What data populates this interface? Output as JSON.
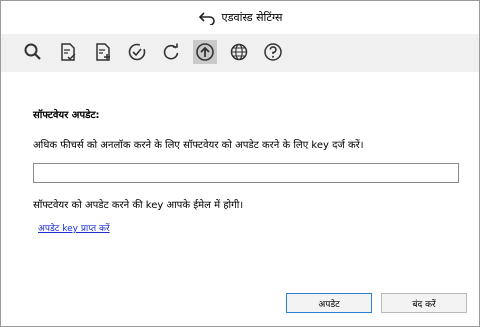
{
  "window": {
    "title": "एडवांस्ड सेटिंग्स"
  },
  "toolbar": {
    "items": [
      {
        "icon": "search-icon"
      },
      {
        "icon": "document-check-icon"
      },
      {
        "icon": "document-add-icon"
      },
      {
        "icon": "check-circle-icon"
      },
      {
        "icon": "refresh-icon"
      },
      {
        "icon": "upload-icon",
        "active": true
      },
      {
        "icon": "globe-icon"
      },
      {
        "icon": "help-icon"
      }
    ]
  },
  "main": {
    "heading": "सॉफ्टवेयर अपडेट:",
    "description": "अधिक फीचर्स को अनलॉक करने के लिए सॉफ्टवेयर को अपडेट करने के लिए key दर्ज करें।",
    "key_input": {
      "value": "",
      "placeholder": ""
    },
    "note": "सॉफ्टवेयर को अपडेट करने की key आपके ईमेल में होगी।",
    "link": "अपडेट key प्राप्त करें"
  },
  "footer": {
    "update_label": "अपडेट",
    "close_label": "बंद करें"
  },
  "colors": {
    "toolbar_bg": "#f0f0f0",
    "link": "#1a2fd6",
    "primary_border": "#2b7fd4"
  }
}
